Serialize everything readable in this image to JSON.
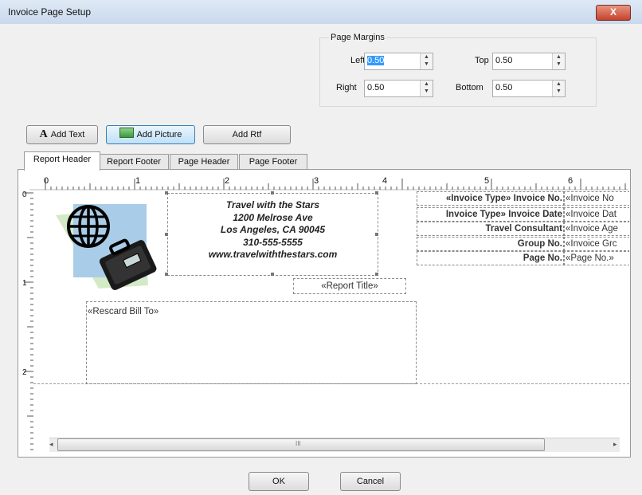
{
  "window": {
    "title": "Invoice Page Setup",
    "close_label": "X"
  },
  "margins": {
    "group_label": "Page Margins",
    "left_label": "Left",
    "left_value": "0.50",
    "top_label": "Top",
    "top_value": "0.50",
    "right_label": "Right",
    "right_value": "0.50",
    "bottom_label": "Bottom",
    "bottom_value": "0.50"
  },
  "toolbar": {
    "add_text": "Add Text",
    "add_picture": "Add Picture",
    "add_rtf": "Add Rtf"
  },
  "tabs": [
    "Report Header",
    "Report Footer",
    "Page Header",
    "Page Footer"
  ],
  "ruler": {
    "h_marks": [
      "0",
      "1",
      "2",
      "3",
      "4",
      "5",
      "6"
    ],
    "v_marks": [
      "0",
      "1",
      "2"
    ]
  },
  "header_text": [
    "Travel with the Stars",
    "1200 Melrose Ave",
    "Los Angeles, CA 90045",
    "310-555-5555",
    "www.travelwiththestars.com"
  ],
  "report_title": "«Report Title»",
  "bill_to": "«Rescard Bill To»",
  "invoice_labels": [
    "«Invoice Type» Invoice No.",
    "Invoice Type» Invoice Date",
    "Travel Consultant",
    "Group No.",
    "Page No."
  ],
  "invoice_values": [
    "«Invoice No",
    "«Invoice Dat",
    "«Invoice Age",
    "«Invoice Grc",
    "«Page No.»"
  ],
  "scrollbar": {
    "grip": "III"
  },
  "buttons": {
    "ok": "OK",
    "cancel": "Cancel"
  }
}
